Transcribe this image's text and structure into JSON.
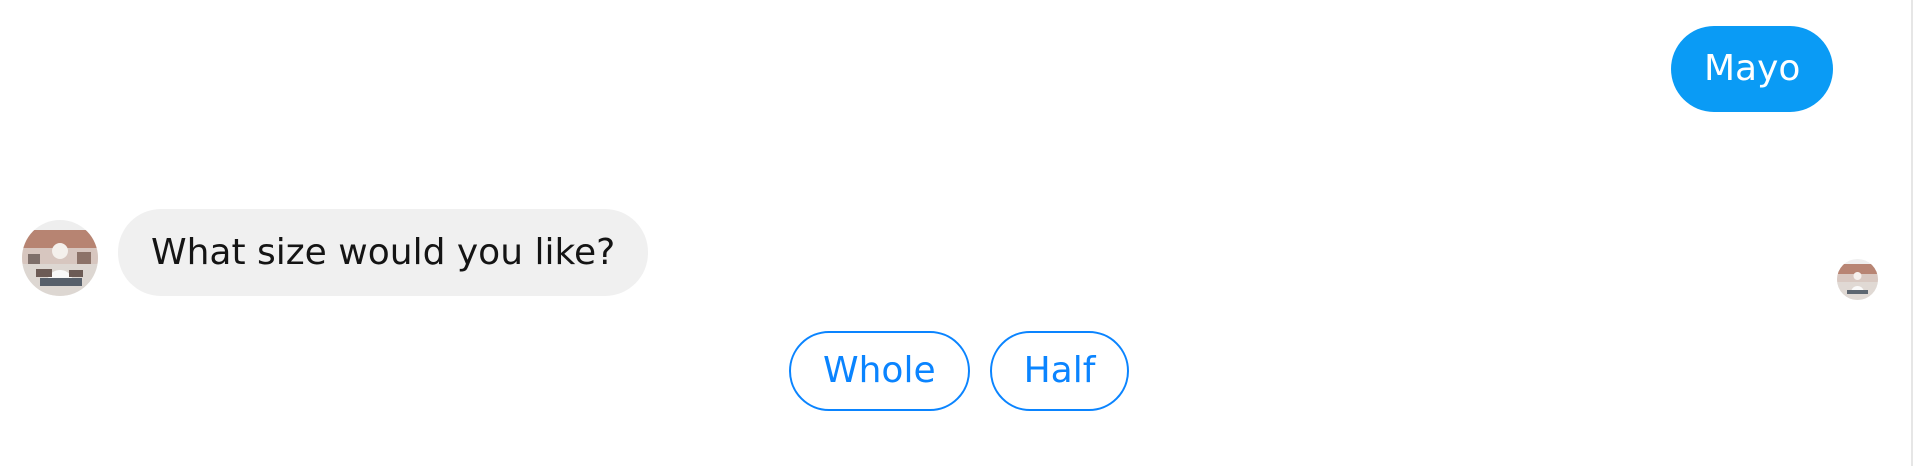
{
  "conversation": {
    "outgoing_message": "Mayo",
    "incoming_message": "What size would you like?",
    "quick_replies": [
      {
        "label": "Whole"
      },
      {
        "label": "Half"
      }
    ]
  },
  "avatars": {
    "sender_icon": "profile-photo-icon",
    "read_receipt_icon": "seen-avatar-icon"
  },
  "colors": {
    "outgoing_bubble": "#0a9bf5",
    "incoming_bubble": "#f0f0f0",
    "quick_reply_accent": "#0a84ff"
  }
}
